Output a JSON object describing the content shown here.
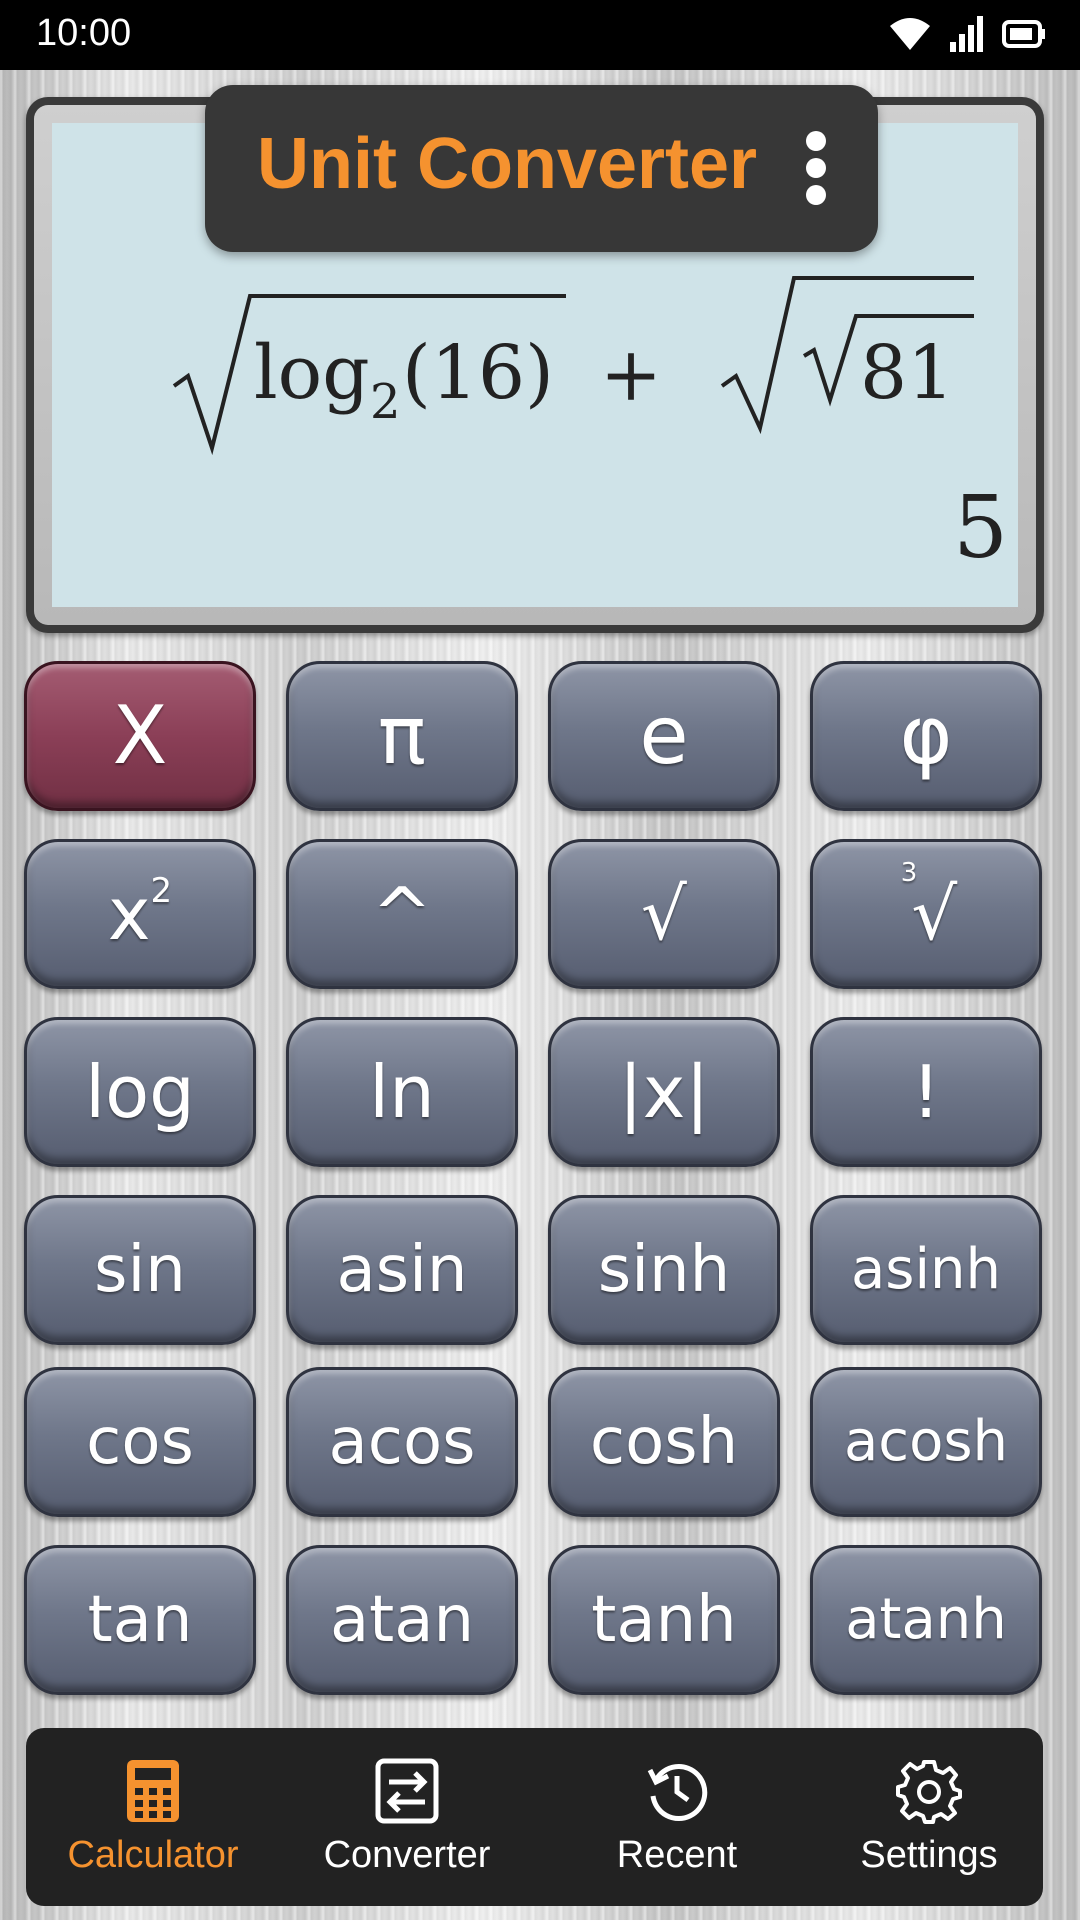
{
  "status_bar": {
    "time": "10:00",
    "icons": [
      "wifi-icon",
      "signal-icon",
      "battery-icon"
    ]
  },
  "display": {
    "expression": {
      "log_text": "log",
      "log_base": "2",
      "log_arg": "(16)",
      "operator": "+",
      "inner_radicand": "81"
    },
    "result": "5"
  },
  "popup": {
    "title": "Unit Converter",
    "menu_icon": "more-vert-icon"
  },
  "keypad": {
    "rows": [
      [
        "X",
        "π",
        "e",
        "φ"
      ],
      [
        "x²",
        "^",
        "√",
        "∛"
      ],
      [
        "log",
        "ln",
        "|x|",
        "!"
      ],
      [
        "sin",
        "asin",
        "sinh",
        "asinh"
      ],
      [
        "cos",
        "acos",
        "cosh",
        "acosh"
      ],
      [
        "tan",
        "atan",
        "tanh",
        "atanh"
      ]
    ],
    "x2_base": "x",
    "x2_exp": "2",
    "cbrt_index": "3",
    "cbrt_symbol": "√"
  },
  "nav": {
    "items": [
      {
        "label": "Calculator",
        "icon": "calculator-icon",
        "active": true
      },
      {
        "label": "Converter",
        "icon": "swap-icon",
        "active": false
      },
      {
        "label": "Recent",
        "icon": "history-icon",
        "active": false
      },
      {
        "label": "Settings",
        "icon": "gear-icon",
        "active": false
      }
    ]
  },
  "colors": {
    "accent": "#f5922f",
    "active_key": "#8b3f57",
    "key": "#6f778a",
    "screen": "#cfe3e8"
  }
}
